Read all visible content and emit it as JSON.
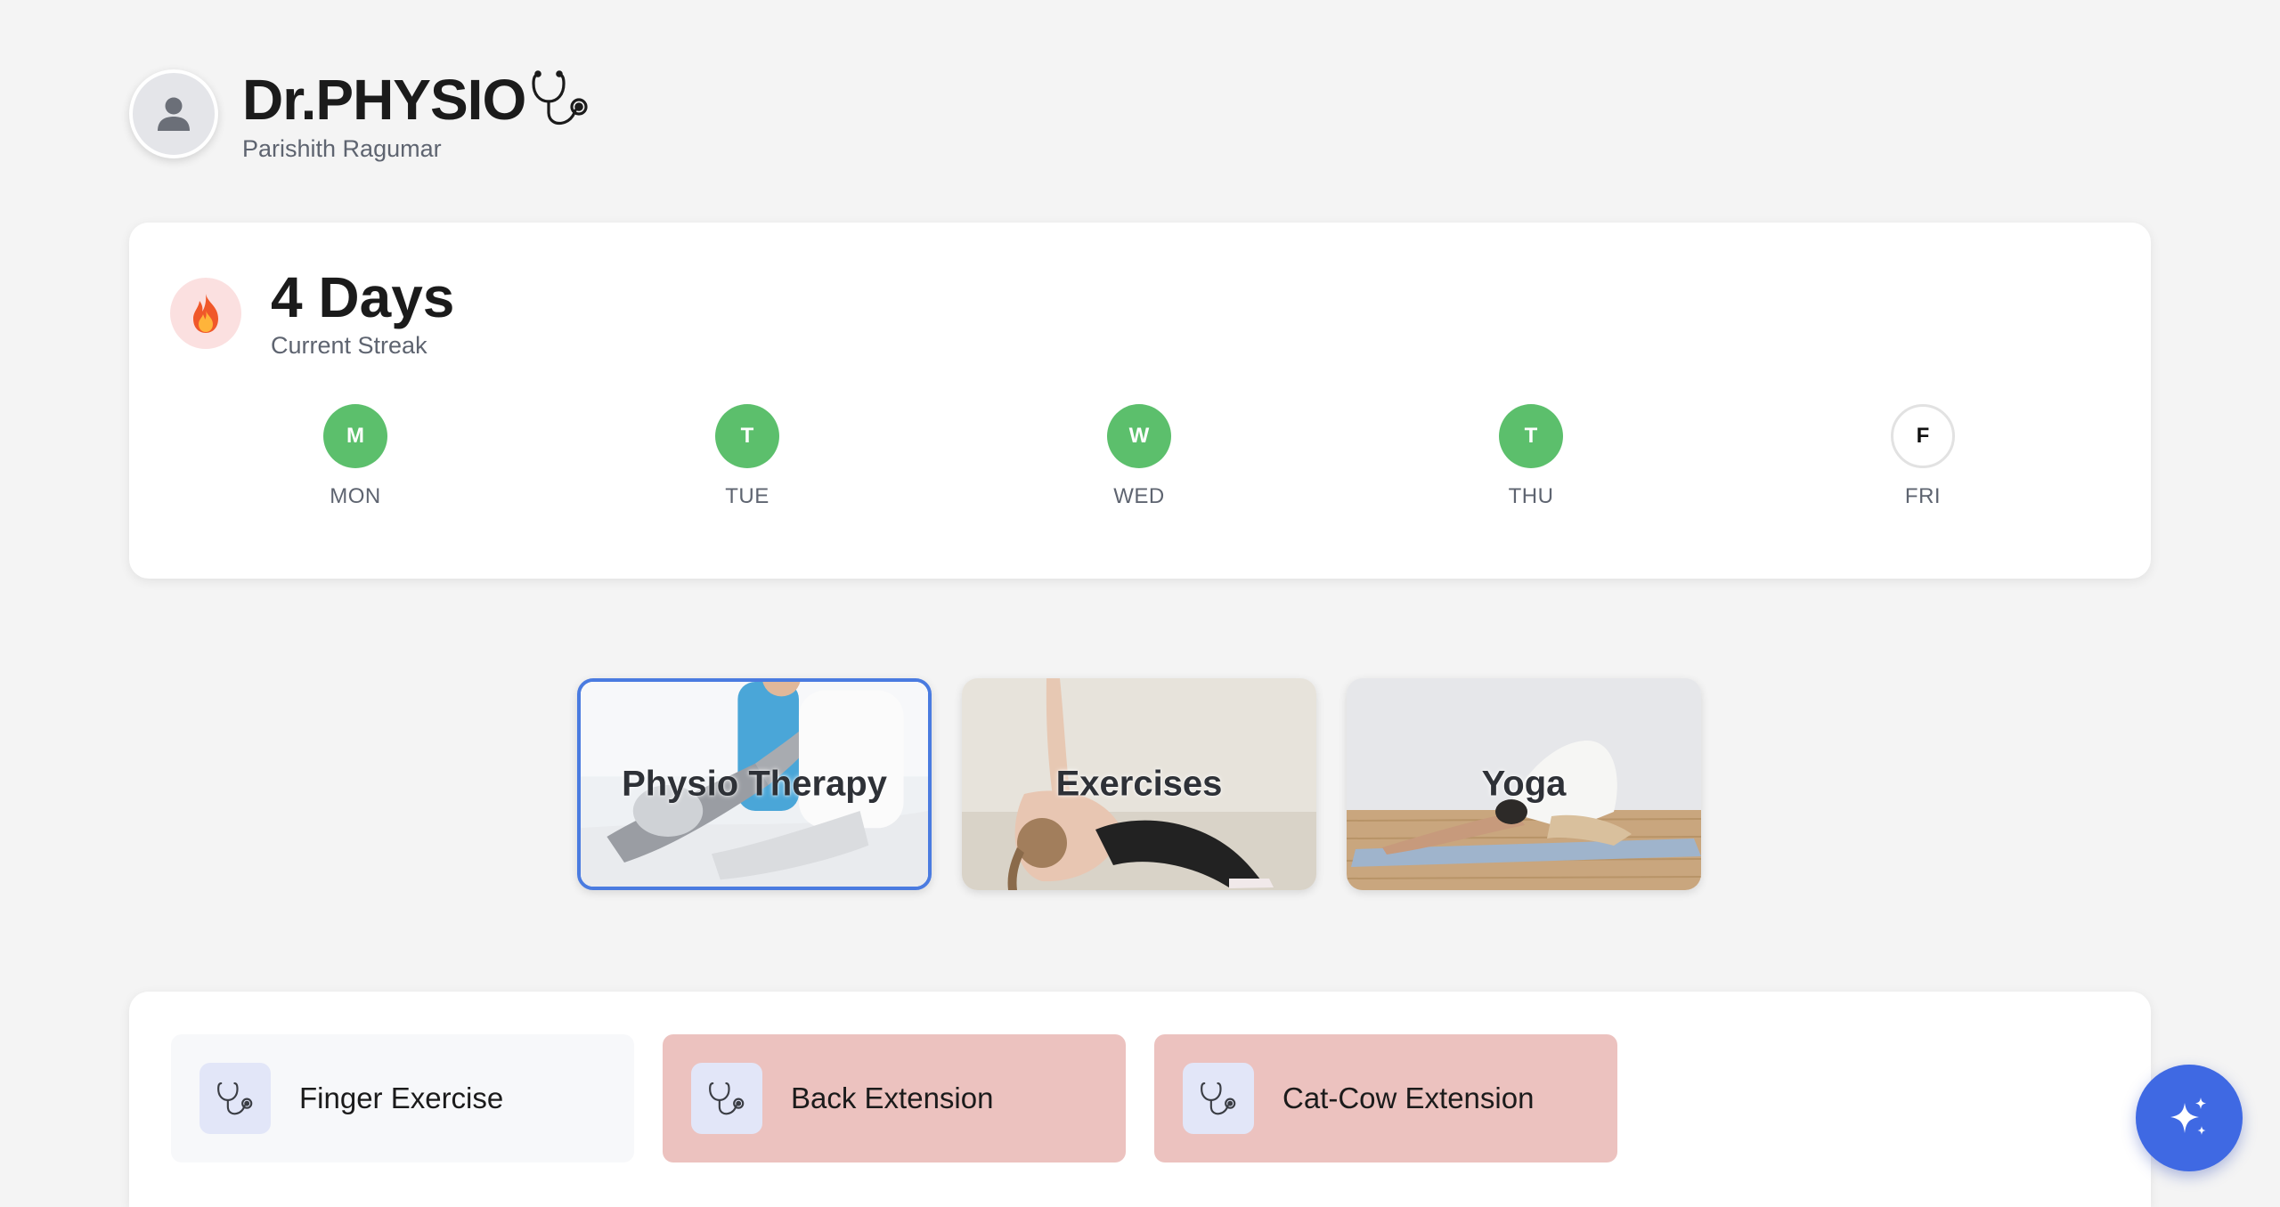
{
  "header": {
    "title": "Dr.PHYSIO",
    "subtitle": "Parishith Ragumar",
    "avatar_icon": "user-icon",
    "brand_icon": "stethoscope-icon"
  },
  "streak": {
    "value": "4 Days",
    "label": "Current Streak",
    "icon": "flame-icon",
    "days": [
      {
        "letter": "M",
        "label": "MON",
        "completed": true
      },
      {
        "letter": "T",
        "label": "TUE",
        "completed": true
      },
      {
        "letter": "W",
        "label": "WED",
        "completed": true
      },
      {
        "letter": "T",
        "label": "THU",
        "completed": true
      },
      {
        "letter": "F",
        "label": "FRI",
        "completed": false
      }
    ]
  },
  "categories": [
    {
      "label": "Physio Therapy",
      "selected": true
    },
    {
      "label": "Exercises",
      "selected": false
    },
    {
      "label": "Yoga",
      "selected": false
    }
  ],
  "exercises": [
    {
      "label": "Finger Exercise",
      "icon": "stethoscope-icon",
      "status": "neutral"
    },
    {
      "label": "Back Extension",
      "icon": "stethoscope-icon",
      "status": "flagged"
    },
    {
      "label": "Cat-Cow Extension",
      "icon": "stethoscope-icon",
      "status": "flagged"
    }
  ],
  "fab": {
    "icon": "sparkles-icon"
  },
  "colors": {
    "accent": "#3f69e3",
    "done": "#5cbf6c",
    "selected_border": "#4a7be0",
    "flagged": "#ecc2bf",
    "icon_bg": "#e2e6f8"
  }
}
